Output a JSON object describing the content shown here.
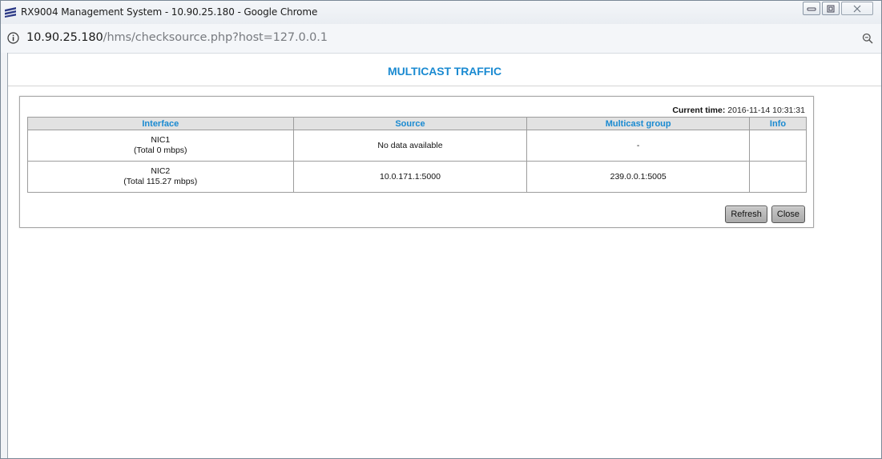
{
  "window": {
    "title": "RX9004 Management System - 10.90.25.180 - Google Chrome",
    "url_host": "10.90.25.180",
    "url_path": "/hms/checksource.php?host=127.0.0.1"
  },
  "page": {
    "title": "MULTICAST TRAFFIC",
    "current_time_label": "Current time:",
    "current_time_value": "2016-11-14 10:31:31"
  },
  "table": {
    "headers": [
      "Interface",
      "Source",
      "Multicast group",
      "Info"
    ],
    "rows": [
      {
        "interface_name": "NIC1",
        "interface_total": "(Total 0 mbps)",
        "source": "No data available",
        "group": "-",
        "info": ""
      },
      {
        "interface_name": "NIC2",
        "interface_total": "(Total 115.27 mbps)",
        "source": "10.0.171.1:5000",
        "group": "239.0.0.1:5005",
        "info": ""
      }
    ]
  },
  "buttons": {
    "refresh": "Refresh",
    "close": "Close"
  },
  "colors": {
    "accent": "#1a8ad1",
    "header_bg": "#e2e2e2",
    "button_bg": "#b9b9b9"
  },
  "icons": [
    "ericsson-logo-icon",
    "info-icon",
    "zoom-icon",
    "minimize-icon",
    "maximize-icon",
    "close-icon"
  ]
}
